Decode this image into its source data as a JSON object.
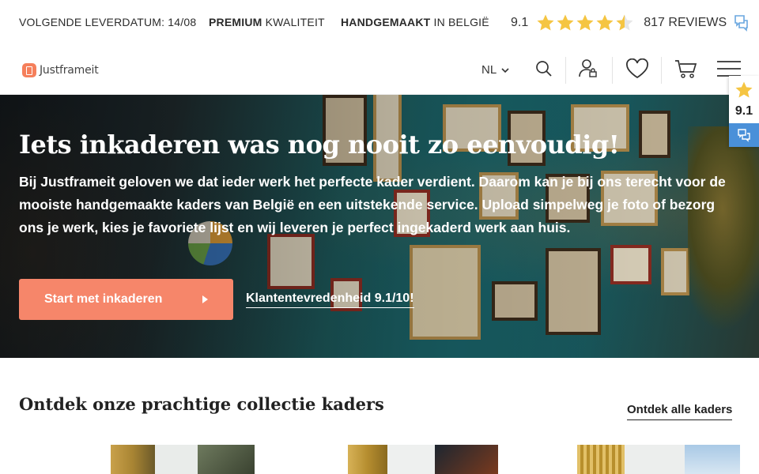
{
  "topbar": {
    "delivery": "VOLGENDE LEVERDATUM: 14/08",
    "quality_bold": "PREMIUM",
    "quality_rest": " KWALITEIT",
    "handmade_bold": "HANDGEMAAKT",
    "handmade_rest": " IN BELGIË",
    "rating_score": "9.1",
    "rating_stars": 4.5,
    "reviews": "817 REVIEWS"
  },
  "nav": {
    "logo": "Justframeit",
    "language": "NL",
    "icons": [
      "search-icon",
      "account-icon",
      "heart-icon",
      "cart-icon",
      "menu-icon"
    ]
  },
  "hero": {
    "title": "Iets inkaderen was nog nooit zo eenvoudig!",
    "text": "Bij Justframeit geloven we dat ieder werk het perfecte kader verdient. Daarom kan je bij ons terecht voor de mooiste handgemaakte kaders van België en een uitstekende service. Upload simpelweg je foto of bezorg ons je werk, kies je favoriete lijst en wij leveren je perfect ingekaderd werk aan huis.",
    "cta": "Start met inkaderen",
    "link": "Klantentevredenheid 9.1/10!"
  },
  "widget": {
    "score": "9.1"
  },
  "collection": {
    "title": "Ontdek onze prachtige collectie kaders",
    "link": "Ontdek alle kaders"
  },
  "colors": {
    "accent": "#f6866a",
    "star": "#f5c542",
    "chat_blue": "#4a90d9"
  }
}
